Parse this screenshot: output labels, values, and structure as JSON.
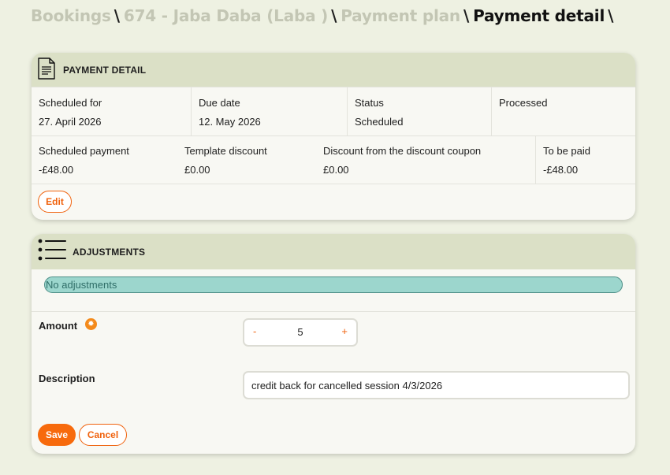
{
  "breadcrumb": {
    "items": [
      "Bookings",
      "674 - Jaba Daba (Laba )",
      "Payment plan"
    ],
    "current": "Payment detail",
    "separator": "\\"
  },
  "payment_detail": {
    "title": "PAYMENT DETAIL",
    "scheduled_for_label": "Scheduled for",
    "scheduled_for_value": "27. April 2026",
    "due_date_label": "Due date",
    "due_date_value": "12. May 2026",
    "status_label": "Status",
    "status_value": "Scheduled",
    "processed_label": "Processed",
    "processed_value": "",
    "scheduled_payment_label": "Scheduled payment",
    "scheduled_payment_value": "-£48.00",
    "template_discount_label": "Template discount",
    "template_discount_value": "£0.00",
    "coupon_discount_label": "Discount from the discount coupon",
    "coupon_discount_value": "£0.00",
    "to_be_paid_label": "To be paid",
    "to_be_paid_value": "-£48.00",
    "edit_label": "Edit"
  },
  "adjustments": {
    "title": "ADJUSTMENTS",
    "empty_message": "No adjustments",
    "amount_label": "Amount",
    "amount_minus": "-",
    "amount_value": "5",
    "amount_plus": "+",
    "description_label": "Description",
    "description_value": "credit back for cancelled session 4/3/2026",
    "save_label": "Save",
    "cancel_label": "Cancel"
  },
  "colors": {
    "accent": "#f76a0c",
    "header_bg": "#dbe0c6",
    "page_bg": "#eef1e2",
    "info_pill": "#9cd6cd"
  },
  "icons": {
    "payment_detail": "document-icon",
    "adjustments": "list-icon",
    "amount_info": "info-icon"
  }
}
